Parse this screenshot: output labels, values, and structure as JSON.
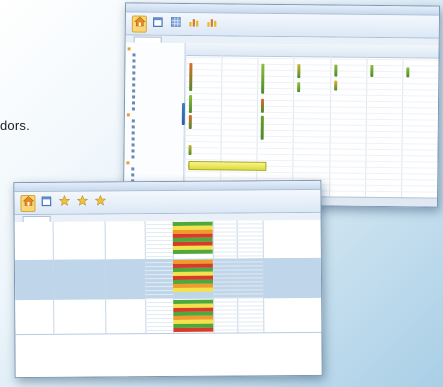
{
  "caption_fragment": "dors.",
  "colors": {
    "accent_yellow": "#f8d77a",
    "grid_line": "#b9cbe0",
    "selected_row": "#bfd6ea",
    "red": "#d73b2a",
    "green": "#4fa83a",
    "orange": "#f09b2a",
    "yellow": "#f4e24a"
  },
  "window_back": {
    "title": "",
    "ribbon_buttons": [
      {
        "icon": "home-icon",
        "selected": true
      },
      {
        "icon": "calendar-icon",
        "selected": false
      },
      {
        "icon": "grid-icon",
        "selected": false
      },
      {
        "icon": "chart-icon",
        "selected": false
      },
      {
        "icon": "chart-icon",
        "selected": false
      }
    ],
    "tabs": [
      ""
    ],
    "tree_nodes": [
      "",
      "",
      "",
      "",
      "",
      "",
      "",
      "",
      "",
      "",
      "",
      "",
      "",
      "",
      "",
      "",
      "",
      "",
      "",
      "",
      "",
      "",
      "",
      "",
      "",
      "",
      ""
    ],
    "columns": [
      "",
      "",
      "",
      "",
      "",
      "",
      ""
    ],
    "status_text": ""
  },
  "window_front": {
    "title": "",
    "ribbon_buttons": [
      {
        "icon": "home-icon",
        "selected": true
      },
      {
        "icon": "calendar-icon",
        "selected": false
      },
      {
        "icon": "star-icon",
        "selected": false
      },
      {
        "icon": "star-icon",
        "selected": false
      },
      {
        "icon": "star-icon",
        "selected": false
      }
    ],
    "tabs": [
      ""
    ],
    "rows": [
      {
        "cells": [
          "",
          "",
          ""
        ],
        "selected": false
      },
      {
        "cells": [
          "",
          "",
          ""
        ],
        "selected": true
      },
      {
        "cells": [
          "",
          "",
          ""
        ],
        "selected": false
      }
    ],
    "status_colors": [
      [
        "green",
        "yellow",
        "orange",
        "red",
        "green",
        "red",
        "yellow",
        "green"
      ],
      [
        "orange",
        "red",
        "green",
        "yellow",
        "red",
        "green",
        "orange",
        "yellow"
      ],
      [
        "green",
        "yellow",
        "red",
        "green",
        "orange",
        "yellow",
        "green",
        "red"
      ]
    ]
  }
}
